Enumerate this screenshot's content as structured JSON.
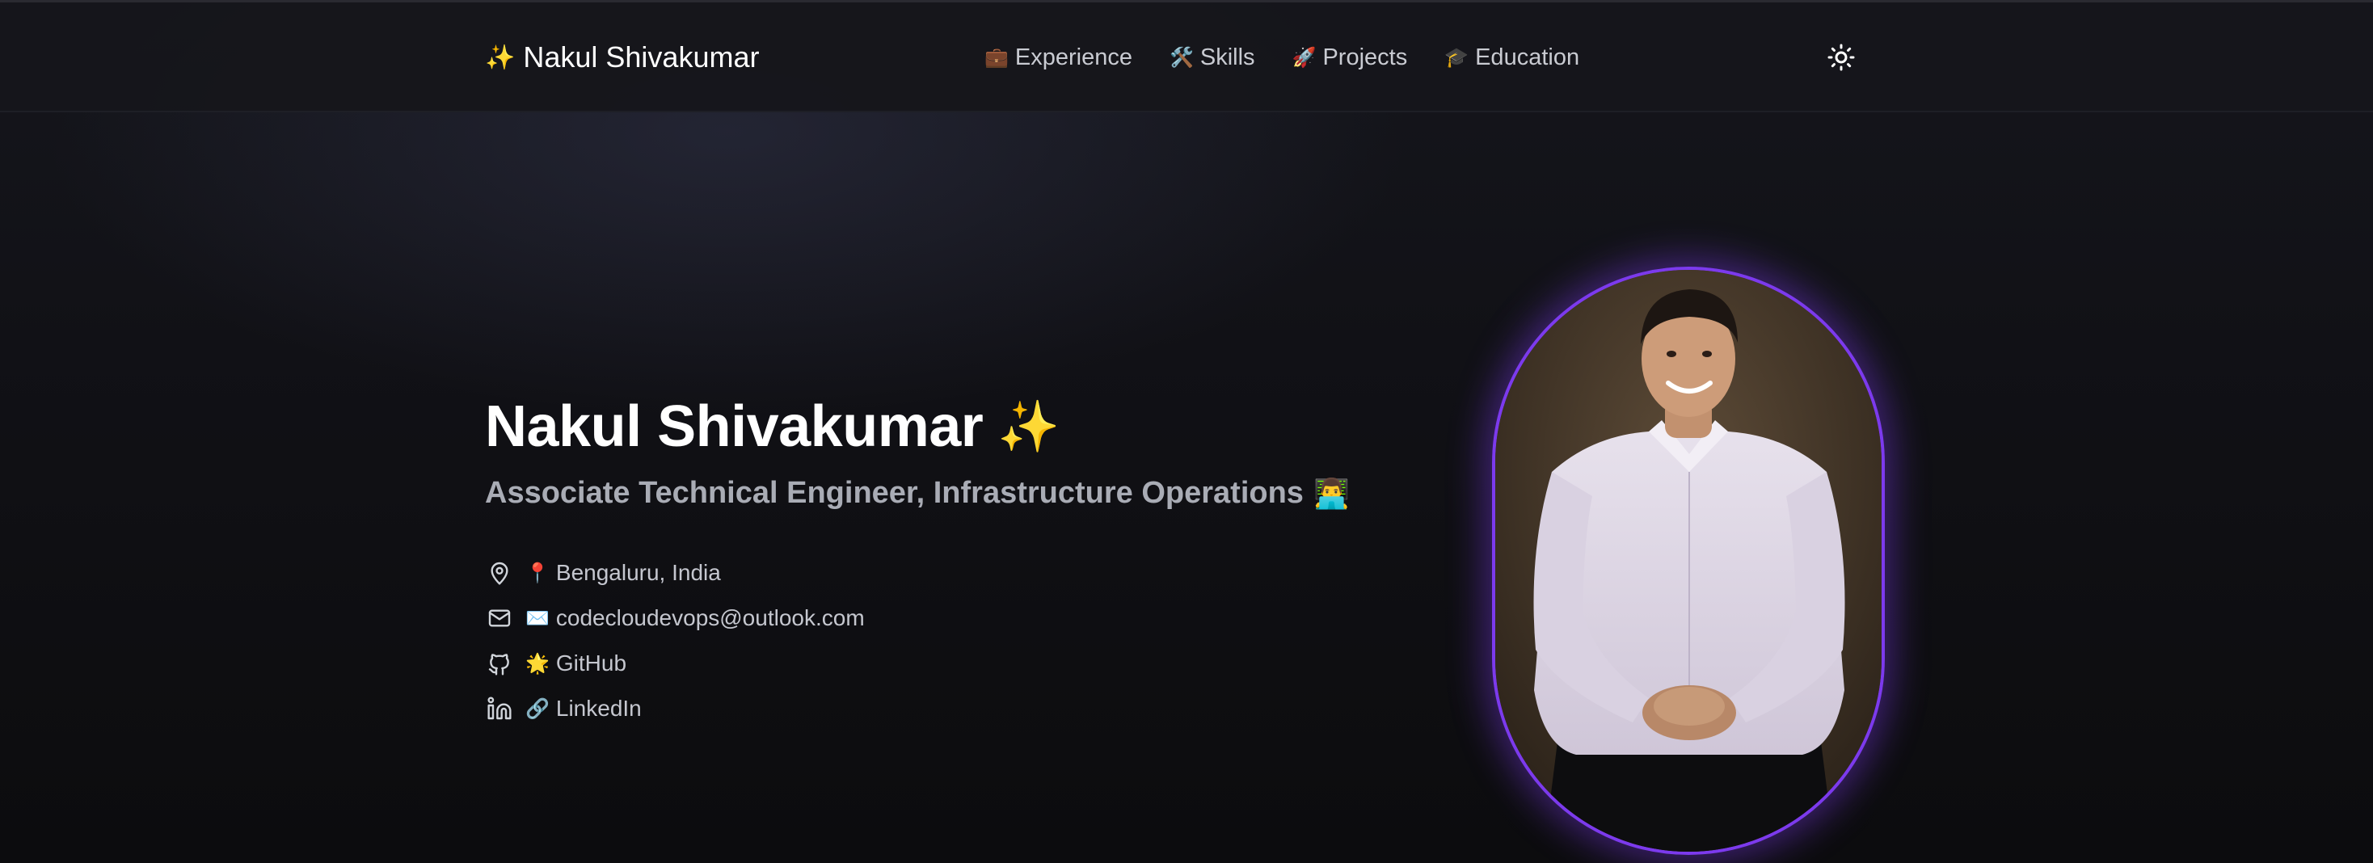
{
  "navbar": {
    "brand": {
      "icon": "sparkles-emoji",
      "glyph": "✨",
      "name": "Nakul Shivakumar"
    },
    "links": [
      {
        "icon": "briefcase-emoji",
        "glyph": "💼",
        "label": "Experience"
      },
      {
        "icon": "hammer-and-wrench-emoji",
        "glyph": "🛠️",
        "label": "Skills"
      },
      {
        "icon": "rocket-emoji",
        "glyph": "🚀",
        "label": "Projects"
      },
      {
        "icon": "graduation-cap-emoji",
        "glyph": "🎓",
        "label": "Education"
      }
    ],
    "theme_toggle": {
      "icon": "sun-icon"
    }
  },
  "hero": {
    "name": "Nakul Shivakumar",
    "name_glyph": "✨",
    "title": "Associate Technical Engineer, Infrastructure Operations",
    "title_glyph": "👨‍💻",
    "contacts": [
      {
        "icon": "map-pin-icon",
        "glyph": "📍",
        "text": "Bengaluru, India"
      },
      {
        "icon": "mail-icon",
        "glyph": "✉️",
        "text": "codecloudevops@outlook.com"
      },
      {
        "icon": "github-icon",
        "glyph": "🌟",
        "text": "GitHub"
      },
      {
        "icon": "linkedin-icon",
        "glyph": "🔗",
        "text": "LinkedIn"
      }
    ]
  },
  "colors": {
    "background": "#0f0f12",
    "navbar": "#16161b",
    "accent": "#7c3aed",
    "text_primary": "#ffffff",
    "text_secondary": "#a9acb5"
  }
}
